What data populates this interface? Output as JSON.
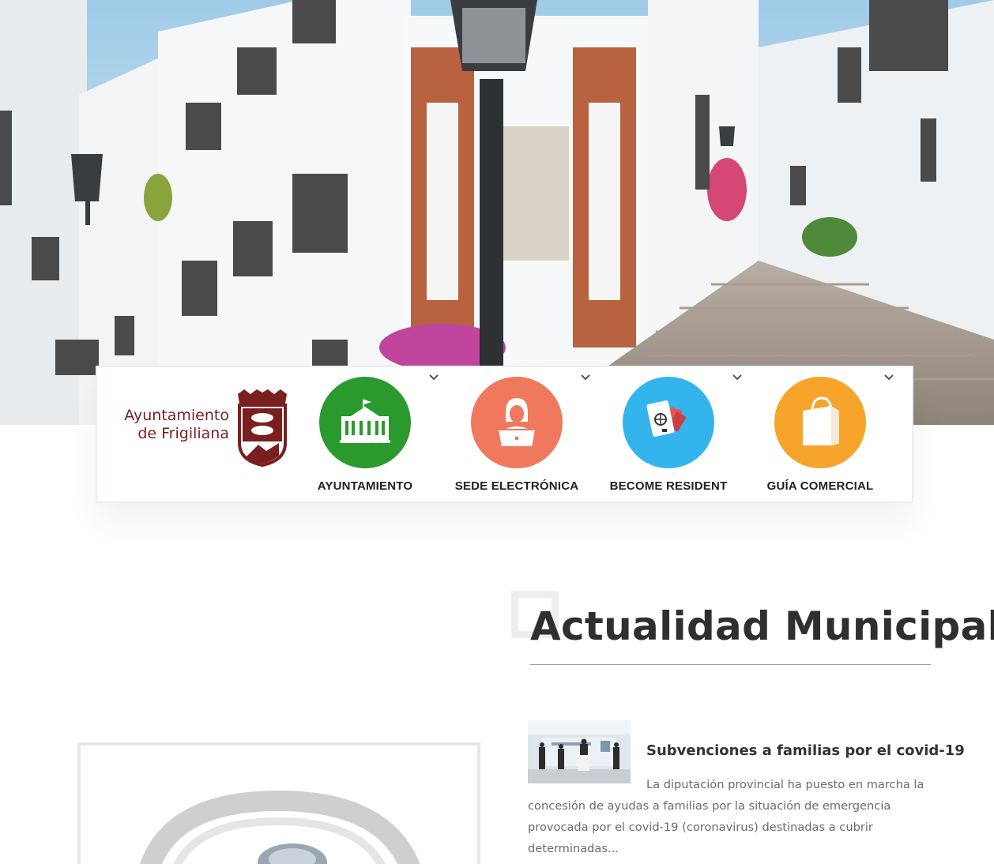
{
  "nav": {
    "items": [
      {
        "label": "AYUNTAMIENTO",
        "color": "#2a9a2e",
        "icon": "town-hall-icon"
      },
      {
        "label": "SEDE ELECTRÓNICA",
        "color": "#f0785c",
        "icon": "clerk-laptop-icon"
      },
      {
        "label": "BECOME RESIDENT",
        "color": "#33b4ec",
        "icon": "passport-icon"
      },
      {
        "label": "GUÍA COMERCIAL",
        "color": "#f7a42a",
        "icon": "shopping-bag-icon"
      }
    ]
  },
  "logo": {
    "line1": "Ayuntamiento",
    "line2": "de Frigiliana",
    "color": "#7a1f1f"
  },
  "section": {
    "title": "Actualidad Municipal"
  },
  "news": {
    "title": "Subvenciones a familias por el covid-19",
    "excerpt": "La diputación provincial ha puesto en marcha la concesión de ayudas a familias por la situación de emergencia provocada por el covid-19 (coronavirus) destinadas a cubrir determinadas..."
  }
}
